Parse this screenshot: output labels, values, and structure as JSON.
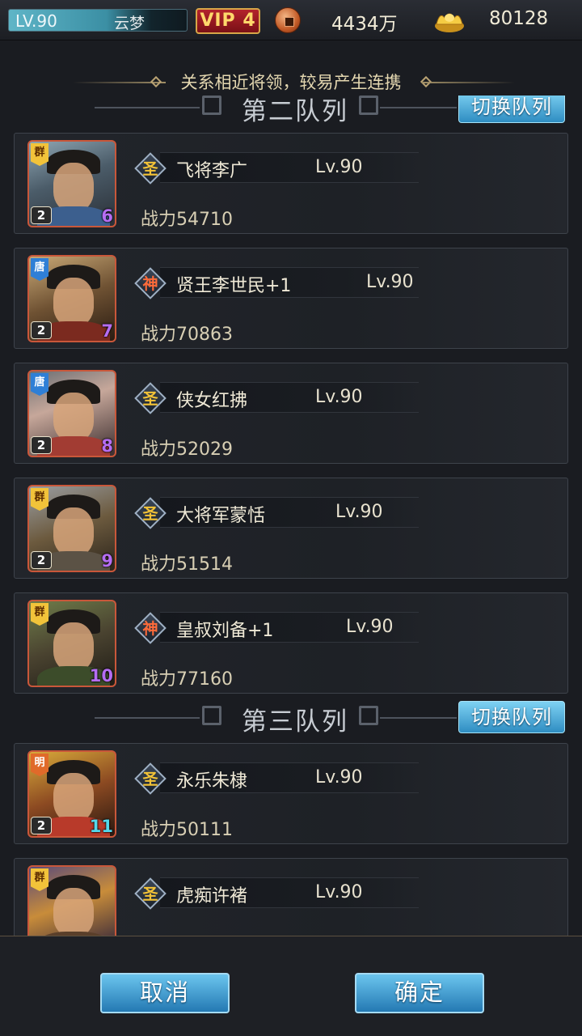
{
  "topbar": {
    "level": "LV.90",
    "player_name": "云梦",
    "vip": "VIP 4",
    "copper": "4434万",
    "gold": "80128"
  },
  "hint": "关系相近将领，较易产生连携",
  "sections": [
    {
      "title": "第二队列",
      "switch_label": "切换队列"
    },
    {
      "title": "第三队列",
      "switch_label": "切换队列"
    }
  ],
  "generals": [
    {
      "faction": "群",
      "rank": "2",
      "slot": "6",
      "grade": "圣",
      "name": "飞将李广",
      "level": "Lv.90",
      "power": "战力54710"
    },
    {
      "faction": "唐",
      "rank": "2",
      "slot": "7",
      "grade": "神",
      "name": "贤王李世民+1",
      "level": "Lv.90",
      "power": "战力70863"
    },
    {
      "faction": "唐",
      "rank": "2",
      "slot": "8",
      "grade": "圣",
      "name": "侠女红拂",
      "level": "Lv.90",
      "power": "战力52029"
    },
    {
      "faction": "群",
      "rank": "2",
      "slot": "9",
      "grade": "圣",
      "name": "大将军蒙恬",
      "level": "Lv.90",
      "power": "战力51514"
    },
    {
      "faction": "群",
      "rank": "",
      "slot": "10",
      "grade": "神",
      "name": "皇叔刘备+1",
      "level": "Lv.90",
      "power": "战力77160"
    },
    {
      "faction": "明",
      "rank": "2",
      "slot": "11",
      "grade": "圣",
      "name": "永乐朱棣",
      "level": "Lv.90",
      "power": "战力50111"
    },
    {
      "faction": "群",
      "rank": "",
      "slot": "",
      "grade": "圣",
      "name": "虎痴许褚",
      "level": "Lv.90",
      "power": ""
    }
  ],
  "buttons": {
    "cancel": "取消",
    "confirm": "确定"
  },
  "colors": {
    "accent_button": "#3f9fd4",
    "slot_purple": "#b56df2",
    "slot_cyan": "#54d8ec",
    "grade_sheng": "#f3c337",
    "grade_shen": "#ff6b3a"
  }
}
